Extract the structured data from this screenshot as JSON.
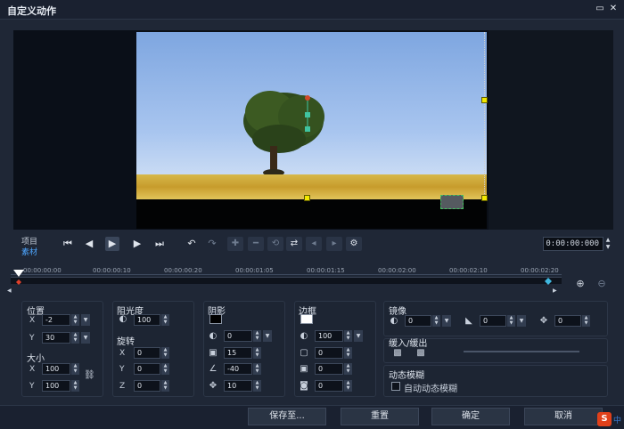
{
  "window": {
    "title": "自定义动作",
    "maximize_icon": "maximize-icon",
    "close_icon": "close-icon"
  },
  "player": {
    "project_label": "项目",
    "material_label": "素材",
    "timecode": "0:00:00:000"
  },
  "timeline": {
    "ticks": [
      "00:00:00:00",
      "00:00:00:10",
      "00:00:00:20",
      "00:00:01:05",
      "00:00:01:15",
      "00:00:02:00",
      "00:00:02:10",
      "00:00:02:20"
    ]
  },
  "position": {
    "title": "位置",
    "x_label": "X",
    "x": "-2",
    "y_label": "Y",
    "y": "30"
  },
  "size": {
    "title": "大小",
    "x_label": "X",
    "x": "100",
    "y_label": "Y",
    "y": "100"
  },
  "opacity": {
    "title": "阻光度",
    "value": "100"
  },
  "rotation": {
    "title": "旋转",
    "x_label": "X",
    "x": "0",
    "y_label": "Y",
    "y": "0",
    "z_label": "Z",
    "z": "0"
  },
  "shadow": {
    "title": "阴影",
    "color": "#000000",
    "opacity": "0",
    "blur": "15",
    "angle": "-40",
    "distance": "10"
  },
  "border": {
    "title": "边框",
    "color": "#ffffff",
    "opacity": "100",
    "width": "0",
    "radius": "0",
    "blur": "0"
  },
  "mirror": {
    "title": "镜像",
    "a": "0",
    "b": "0",
    "c": "0"
  },
  "ease": {
    "title": "缓入/缓出"
  },
  "motion_blur": {
    "title": "动态模糊",
    "checkbox_label": "自动动态模糊"
  },
  "buttons": {
    "save": "保存至...",
    "reset": "重置",
    "ok": "确定",
    "cancel": "取消"
  },
  "ime": {
    "logo": "S",
    "text": "中"
  }
}
